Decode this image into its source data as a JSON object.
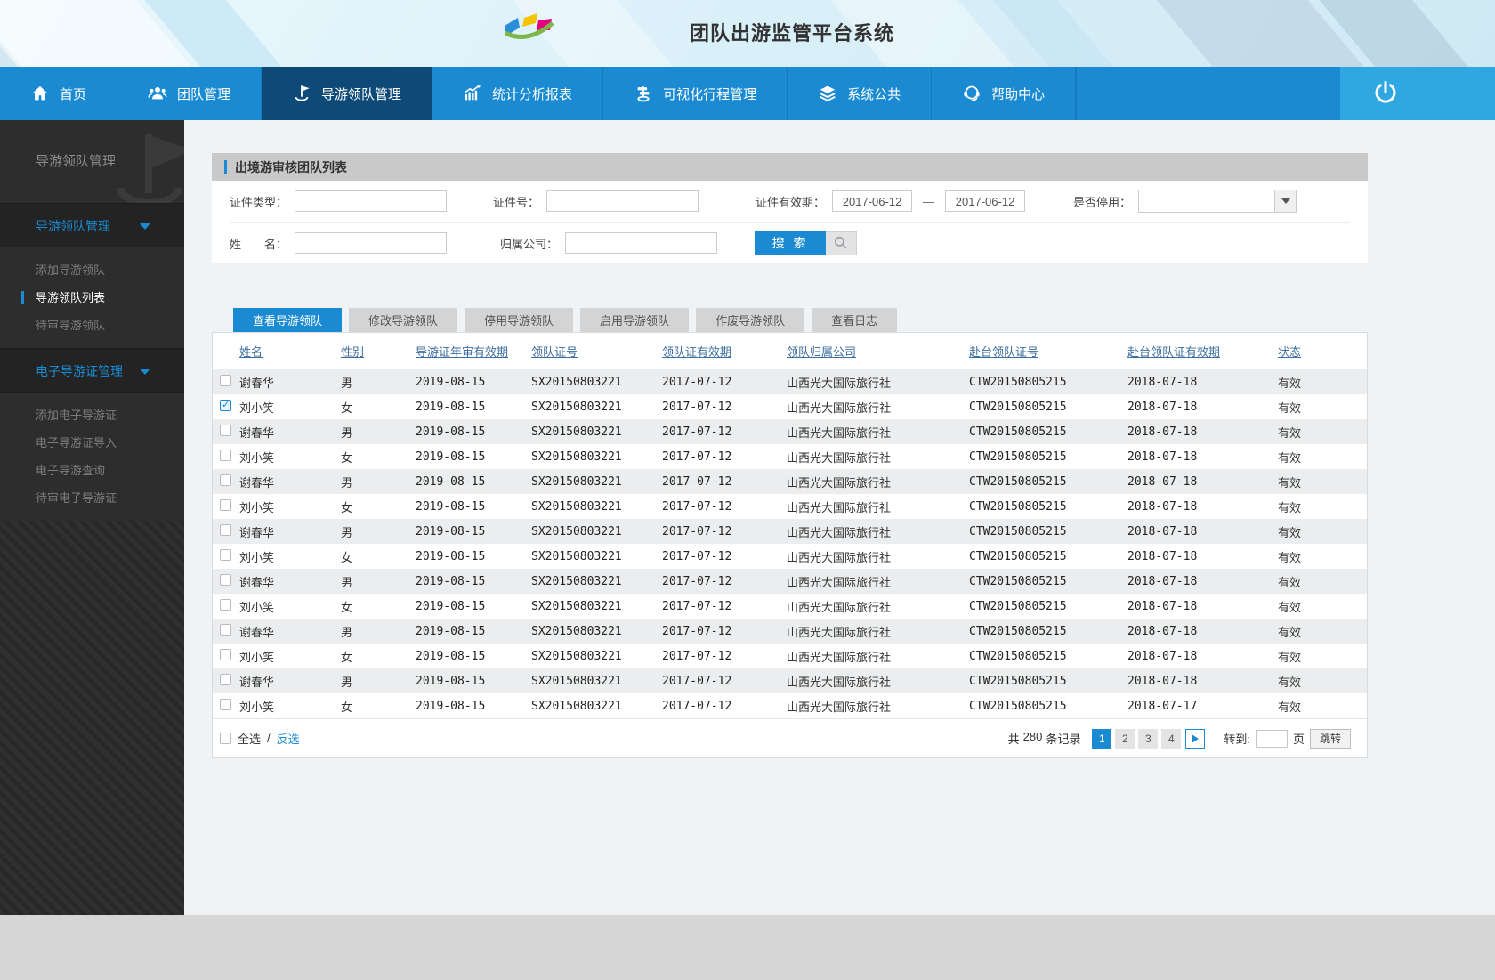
{
  "header": {
    "title": "团队出游监管平台系统",
    "logo": "ribbon-logo"
  },
  "nav": {
    "items": [
      {
        "label": "首页",
        "icon": "home-icon",
        "active": false
      },
      {
        "label": "团队管理",
        "icon": "team-icon",
        "active": false
      },
      {
        "label": "导游领队管理",
        "icon": "flag-icon",
        "active": true
      },
      {
        "label": "统计分析报表",
        "icon": "chart-icon",
        "active": false
      },
      {
        "label": "可视化行程管理",
        "icon": "signpost-icon",
        "active": false
      },
      {
        "label": "系统公共",
        "icon": "layers-icon",
        "active": false
      },
      {
        "label": "帮助中心",
        "icon": "headset-icon",
        "active": false
      }
    ],
    "power_icon": "power-icon"
  },
  "sidebar": {
    "title": "导游领队管理",
    "groups": [
      {
        "label": "导游领队管理",
        "items": [
          {
            "label": "添加导游领队",
            "active": false
          },
          {
            "label": "导游领队列表",
            "active": true
          },
          {
            "label": "待审导游领队",
            "active": false
          }
        ]
      },
      {
        "label": "电子导游证管理",
        "items": [
          {
            "label": "添加电子导游证",
            "active": false
          },
          {
            "label": "电子导游证导入",
            "active": false
          },
          {
            "label": "电子导游查询",
            "active": false
          },
          {
            "label": "待审电子导游证",
            "active": false
          }
        ]
      }
    ]
  },
  "panel": {
    "title": "出境游审核团队列表",
    "form": {
      "cert_type_label": "证件类型：",
      "cert_no_label": "证件号：",
      "validity_label": "证件有效期：",
      "validity_from": "2017-06-12",
      "validity_dash": "—",
      "validity_to": "2017-06-12",
      "disabled_label": "是否停用：",
      "name_label": "姓　　名：",
      "company_label": "归属公司：",
      "search_label": "搜 索"
    },
    "tabs": [
      {
        "label": "查看导游领队",
        "active": true
      },
      {
        "label": "修改导游领队",
        "active": false
      },
      {
        "label": "停用导游领队",
        "active": false
      },
      {
        "label": "启用导游领队",
        "active": false
      },
      {
        "label": "作废导游领队",
        "active": false
      },
      {
        "label": "查看日志",
        "active": false
      }
    ],
    "table": {
      "headers": [
        "姓名",
        "性别",
        "导游证年审有效期",
        "领队证号",
        "领队证有效期",
        "领队归属公司",
        "赴台领队证号",
        "赴台领队证有效期",
        "状态"
      ],
      "rows": [
        {
          "checked": false,
          "name": "谢春华",
          "gender": "男",
          "annual": "2019-08-15",
          "leader_no": "SX20150803221",
          "leader_valid": "2017-07-12",
          "company": "山西光大国际旅行社",
          "taiwan_no": "CTW20150805215",
          "taiwan_valid": "2018-07-18",
          "status": "有效"
        },
        {
          "checked": true,
          "name": "刘小笑",
          "gender": "女",
          "annual": "2019-08-15",
          "leader_no": "SX20150803221",
          "leader_valid": "2017-07-12",
          "company": "山西光大国际旅行社",
          "taiwan_no": "CTW20150805215",
          "taiwan_valid": "2018-07-18",
          "status": "有效"
        },
        {
          "checked": false,
          "name": "谢春华",
          "gender": "男",
          "annual": "2019-08-15",
          "leader_no": "SX20150803221",
          "leader_valid": "2017-07-12",
          "company": "山西光大国际旅行社",
          "taiwan_no": "CTW20150805215",
          "taiwan_valid": "2018-07-18",
          "status": "有效"
        },
        {
          "checked": false,
          "name": "刘小笑",
          "gender": "女",
          "annual": "2019-08-15",
          "leader_no": "SX20150803221",
          "leader_valid": "2017-07-12",
          "company": "山西光大国际旅行社",
          "taiwan_no": "CTW20150805215",
          "taiwan_valid": "2018-07-18",
          "status": "有效"
        },
        {
          "checked": false,
          "name": "谢春华",
          "gender": "男",
          "annual": "2019-08-15",
          "leader_no": "SX20150803221",
          "leader_valid": "2017-07-12",
          "company": "山西光大国际旅行社",
          "taiwan_no": "CTW20150805215",
          "taiwan_valid": "2018-07-18",
          "status": "有效"
        },
        {
          "checked": false,
          "name": "刘小笑",
          "gender": "女",
          "annual": "2019-08-15",
          "leader_no": "SX20150803221",
          "leader_valid": "2017-07-12",
          "company": "山西光大国际旅行社",
          "taiwan_no": "CTW20150805215",
          "taiwan_valid": "2018-07-18",
          "status": "有效"
        },
        {
          "checked": false,
          "name": "谢春华",
          "gender": "男",
          "annual": "2019-08-15",
          "leader_no": "SX20150803221",
          "leader_valid": "2017-07-12",
          "company": "山西光大国际旅行社",
          "taiwan_no": "CTW20150805215",
          "taiwan_valid": "2018-07-18",
          "status": "有效"
        },
        {
          "checked": false,
          "name": "刘小笑",
          "gender": "女",
          "annual": "2019-08-15",
          "leader_no": "SX20150803221",
          "leader_valid": "2017-07-12",
          "company": "山西光大国际旅行社",
          "taiwan_no": "CTW20150805215",
          "taiwan_valid": "2018-07-18",
          "status": "有效"
        },
        {
          "checked": false,
          "name": "谢春华",
          "gender": "男",
          "annual": "2019-08-15",
          "leader_no": "SX20150803221",
          "leader_valid": "2017-07-12",
          "company": "山西光大国际旅行社",
          "taiwan_no": "CTW20150805215",
          "taiwan_valid": "2018-07-18",
          "status": "有效"
        },
        {
          "checked": false,
          "name": "刘小笑",
          "gender": "女",
          "annual": "2019-08-15",
          "leader_no": "SX20150803221",
          "leader_valid": "2017-07-12",
          "company": "山西光大国际旅行社",
          "taiwan_no": "CTW20150805215",
          "taiwan_valid": "2018-07-18",
          "status": "有效"
        },
        {
          "checked": false,
          "name": "谢春华",
          "gender": "男",
          "annual": "2019-08-15",
          "leader_no": "SX20150803221",
          "leader_valid": "2017-07-12",
          "company": "山西光大国际旅行社",
          "taiwan_no": "CTW20150805215",
          "taiwan_valid": "2018-07-18",
          "status": "有效"
        },
        {
          "checked": false,
          "name": "刘小笑",
          "gender": "女",
          "annual": "2019-08-15",
          "leader_no": "SX20150803221",
          "leader_valid": "2017-07-12",
          "company": "山西光大国际旅行社",
          "taiwan_no": "CTW20150805215",
          "taiwan_valid": "2018-07-18",
          "status": "有效"
        },
        {
          "checked": false,
          "name": "谢春华",
          "gender": "男",
          "annual": "2019-08-15",
          "leader_no": "SX20150803221",
          "leader_valid": "2017-07-12",
          "company": "山西光大国际旅行社",
          "taiwan_no": "CTW20150805215",
          "taiwan_valid": "2018-07-18",
          "status": "有效"
        },
        {
          "checked": false,
          "name": "刘小笑",
          "gender": "女",
          "annual": "2019-08-15",
          "leader_no": "SX20150803221",
          "leader_valid": "2017-07-12",
          "company": "山西光大国际旅行社",
          "taiwan_no": "CTW20150805215",
          "taiwan_valid": "2018-07-17",
          "status": "有效"
        }
      ]
    },
    "footer": {
      "select_all_label": "全选",
      "separator": "/",
      "invert_label": "反选",
      "total_prefix": "共",
      "total_count": "280",
      "total_suffix": "条记录",
      "pages": [
        {
          "label": "1",
          "active": true
        },
        {
          "label": "2",
          "active": false
        },
        {
          "label": "3",
          "active": false
        },
        {
          "label": "4",
          "active": false
        }
      ],
      "next_icon": "next-page-icon",
      "goto_label": "转到:",
      "page_unit_label": "页",
      "goto_button_label": "跳转"
    }
  },
  "colors": {
    "accent_blue": "#1a8ad2",
    "nav_active_bg": "#0d4a78",
    "power_section_bg": "#2fa8e1",
    "panel_header_bg": "#c9c9c9",
    "row_alt_bg": "#ebedee",
    "table_header_text": "#3c6e9f",
    "sidebar_bg": "#2d2d2d"
  }
}
